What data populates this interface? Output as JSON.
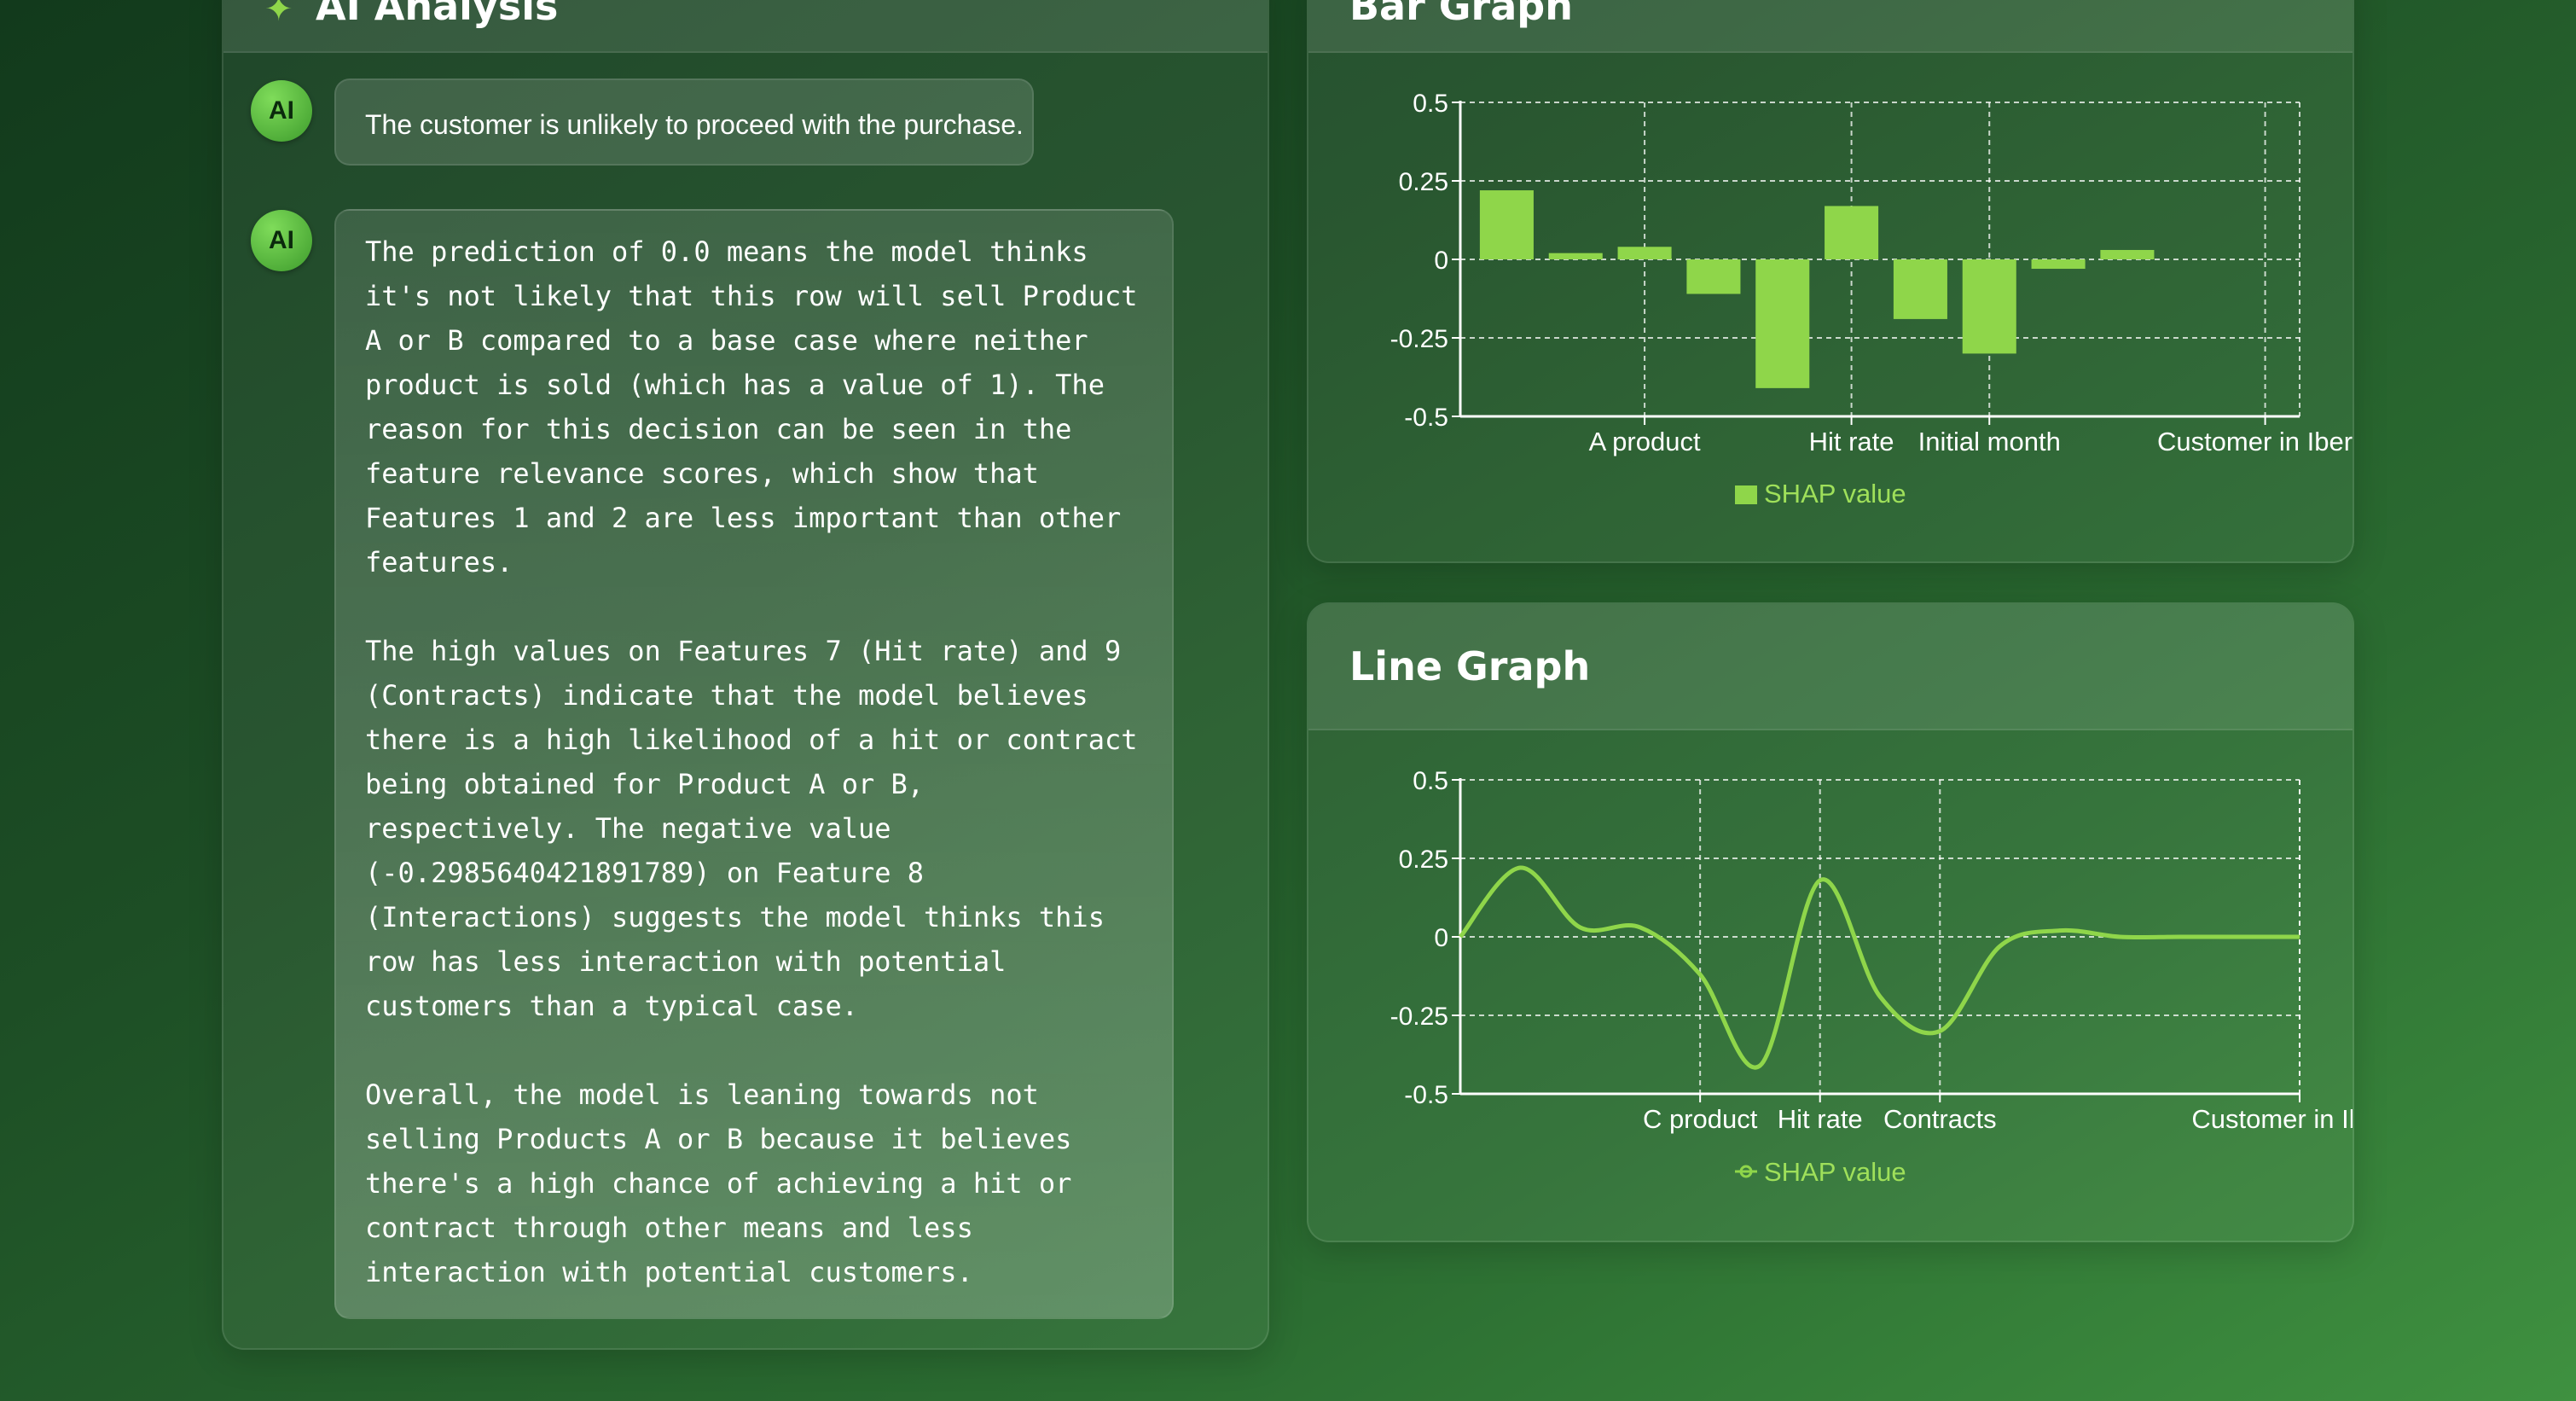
{
  "colors": {
    "accent": "#8fd64a",
    "legend_text": "#9fe05a",
    "background_start": "#123a1c",
    "background_end": "#3f9140"
  },
  "analysis_panel": {
    "title": "AI Analysis",
    "icon": "sparkle-icon",
    "messages": [
      {
        "avatar": "AI",
        "text": "The customer is unlikely to proceed with the purchase."
      },
      {
        "avatar": "AI",
        "text": "The prediction of 0.0 means the model thinks\nit's not likely that this row will sell Product\nA or B compared to a base case where neither\nproduct is sold (which has a value of 1). The\nreason for this decision can be seen in the\nfeature relevance scores, which show that\nFeatures 1 and 2 are less important than other\nfeatures.\n\nThe high values on Features 7 (Hit rate) and 9\n(Contracts) indicate that the model believes\nthere is a high likelihood of a hit or contract\nbeing obtained for Product A or B,\nrespectively. The negative value\n(-0.2985640421891789) on Feature 8\n(Interactions) suggests the model thinks this\nrow has less interaction with potential\ncustomers than a typical case.\n\nOverall, the model is leaning towards not\nselling Products A or B because it believes\nthere's a high chance of achieving a hit or\ncontract through other means and less\ninteraction with potential customers."
      }
    ]
  },
  "bar_panel": {
    "title": "Bar Graph"
  },
  "line_panel": {
    "title": "Line Graph"
  },
  "chart_data": [
    {
      "type": "bar",
      "categories": [
        "",
        "",
        "A product",
        "",
        "",
        "Hit rate",
        "",
        "Initial month",
        "",
        "",
        "",
        "Customer in Iberia"
      ],
      "visible_tick_labels": [
        "A product",
        "Hit rate",
        "Initial month",
        "Customer in Iberia"
      ],
      "series": [
        {
          "name": "SHAP value",
          "values": [
            0.22,
            0.02,
            0.04,
            -0.11,
            -0.41,
            0.17,
            -0.19,
            -0.3,
            -0.03,
            0.03,
            0,
            0
          ]
        }
      ],
      "ylim": [
        -0.5,
        0.5
      ],
      "yticks": [
        "0.5",
        "0.25",
        "0",
        "-0.25",
        "-0.5"
      ],
      "ytick_values": [
        0.5,
        0.25,
        0,
        -0.25,
        -0.5
      ],
      "grid": true,
      "legend": "bottom"
    },
    {
      "type": "line",
      "categories": [
        "",
        "",
        "",
        "",
        "C product",
        "",
        "Hit rate",
        "",
        "Contracts",
        "",
        "",
        "",
        "",
        "",
        "Customer in Iberia"
      ],
      "visible_tick_labels": [
        "C product",
        "Hit rate",
        "Contracts",
        "Customer in Iberia"
      ],
      "series": [
        {
          "name": "SHAP value",
          "values": [
            0,
            0.22,
            0.03,
            0.03,
            -0.12,
            -0.41,
            0.18,
            -0.19,
            -0.3,
            -0.03,
            0.02,
            0,
            0,
            0,
            0
          ]
        }
      ],
      "ylim": [
        -0.5,
        0.5
      ],
      "yticks": [
        "0.5",
        "0.25",
        "0",
        "-0.25",
        "-0.5"
      ],
      "ytick_values": [
        0.5,
        0.25,
        0,
        -0.25,
        -0.5
      ],
      "grid": true,
      "smooth": true,
      "legend": "bottom"
    }
  ]
}
